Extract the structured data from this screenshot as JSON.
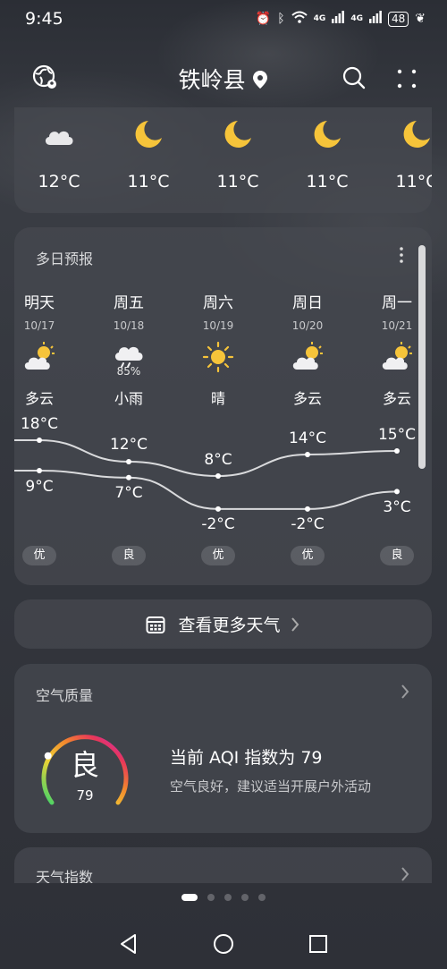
{
  "status": {
    "time": "9:45",
    "battery": "48",
    "net1": "4G",
    "net2": "4G"
  },
  "header": {
    "city": "铁岭县"
  },
  "hourly": [
    {
      "icon": "cloud-icon",
      "temp": "12°C"
    },
    {
      "icon": "moon-icon",
      "temp": "11°C"
    },
    {
      "icon": "moon-icon",
      "temp": "11°C"
    },
    {
      "icon": "moon-icon",
      "temp": "11°C"
    },
    {
      "icon": "moon-icon",
      "temp": "11°C"
    }
  ],
  "daily": {
    "title": "多日预报",
    "days": [
      {
        "name": "明天",
        "date": "10/17",
        "icon": "partly-cloudy-icon",
        "cond": "多云",
        "high": "18°C",
        "low": "9°C",
        "aqi": "优",
        "precip": ""
      },
      {
        "name": "周五",
        "date": "10/18",
        "icon": "light-rain-icon",
        "cond": "小雨",
        "high": "12°C",
        "low": "7°C",
        "aqi": "良",
        "precip": "85%"
      },
      {
        "name": "周六",
        "date": "10/19",
        "icon": "sun-icon",
        "cond": "晴",
        "high": "8°C",
        "low": "-2°C",
        "aqi": "优",
        "precip": ""
      },
      {
        "name": "周日",
        "date": "10/20",
        "icon": "partly-cloudy-icon",
        "cond": "多云",
        "high": "14°C",
        "low": "-2°C",
        "aqi": "优",
        "precip": ""
      },
      {
        "name": "周一",
        "date": "10/21",
        "icon": "partly-cloudy-icon",
        "cond": "多云",
        "high": "15°C",
        "low": "3°C",
        "aqi": "良",
        "precip": ""
      }
    ]
  },
  "more": {
    "label": "查看更多天气"
  },
  "air": {
    "title": "空气质量",
    "level": "良",
    "value": "79",
    "main": "当前 AQI 指数为 79",
    "sub": "空气良好，建议适当开展户外活动"
  },
  "index": {
    "title": "天气指数"
  },
  "pager": {
    "count": 5,
    "active": 0
  }
}
